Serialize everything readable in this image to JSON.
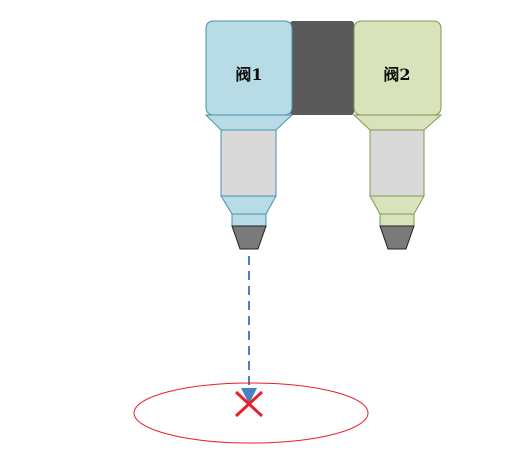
{
  "valves": [
    {
      "label": "阀1",
      "body_color": "#b8dce6",
      "stroke_color": "#4a8fae"
    },
    {
      "label": "阀2",
      "body_color": "#d8e3bc",
      "stroke_color": "#7f9a52"
    }
  ],
  "connector_color": "#595959",
  "nozzle_color": "#7a7a7a",
  "tube_color": "#d9d9d9",
  "dispense_path_color": "#4a7fc1",
  "target_color": "#e8202a"
}
